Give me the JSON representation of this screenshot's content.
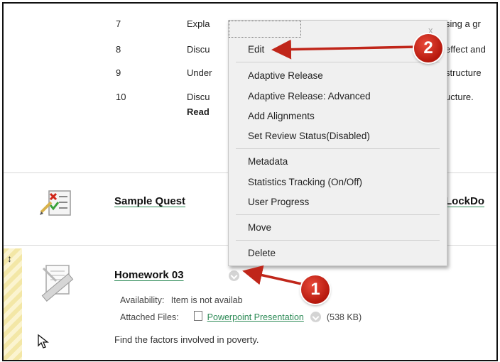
{
  "outline_items": [
    {
      "num": "7",
      "text": "Expla",
      "tail": "sing a gr"
    },
    {
      "num": "8",
      "text": "Discu",
      "tail": "effect and"
    },
    {
      "num": "9",
      "text": "Under",
      "tail": "structure"
    },
    {
      "num": "10",
      "text": "Discu",
      "tail": "ucture."
    }
  ],
  "outline_read": "Read",
  "sample_item": {
    "title_left": "Sample Quest",
    "title_right": "LockDo"
  },
  "homework": {
    "drag_glyph": "↕",
    "title": "Homework 03",
    "availability_label": "Availability:",
    "availability_value": "Item is not availab",
    "attached_label": "Attached Files:",
    "attachment_name": "Powerpoint Presentation",
    "attachment_size": "(538 KB)",
    "description": "Find the factors involved in poverty."
  },
  "context_menu": {
    "close_glyph": "x",
    "edit": "Edit",
    "group1": [
      "Adaptive Release",
      "Adaptive Release: Advanced",
      "Add Alignments",
      "Set Review Status(Disabled)"
    ],
    "group2": [
      "Metadata",
      "Statistics Tracking (On/Off)",
      "User Progress"
    ],
    "move": "Move",
    "delete": "Delete"
  },
  "callouts": {
    "step1": "1",
    "step2": "2"
  },
  "colors": {
    "callout": "#c0261a",
    "link": "#2e8b57",
    "menu_bg": "#f0f0f0",
    "stripe": "#f3e7a6"
  },
  "icons": {
    "quiz": "quiz-checklist-icon",
    "assignment": "assignment-ruler-icon",
    "cursor": "mouse-pointer-icon",
    "file": "document-icon"
  }
}
